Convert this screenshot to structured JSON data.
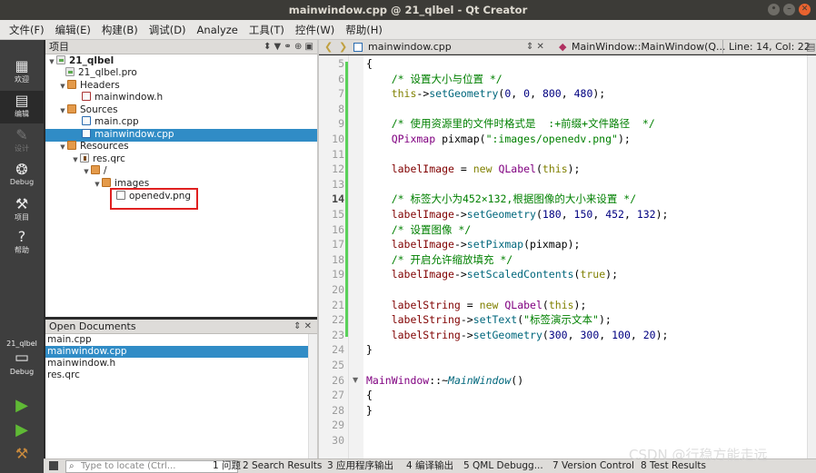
{
  "window": {
    "title": "mainwindow.cpp @ 21_qlbel - Qt Creator",
    "buttons": [
      "•",
      "–",
      "✕"
    ]
  },
  "menubar": [
    "文件(F)",
    "编辑(E)",
    "构建(B)",
    "调试(D)",
    "Analyze",
    "工具(T)",
    "控件(W)",
    "帮助(H)"
  ],
  "modes": [
    {
      "label": "欢迎",
      "icon": "grid-icon",
      "glyph": "▦"
    },
    {
      "label": "编辑",
      "icon": "edit-icon",
      "glyph": "▤"
    },
    {
      "label": "设计",
      "icon": "design-icon",
      "glyph": "✎"
    },
    {
      "label": "Debug",
      "icon": "bug-icon",
      "glyph": "❂"
    },
    {
      "label": "项目",
      "icon": "wrench-icon",
      "glyph": "⚒"
    },
    {
      "label": "帮助",
      "icon": "help-icon",
      "glyph": "?"
    }
  ],
  "kit": {
    "name": "21_qlbel",
    "mode": "Debug"
  },
  "project_pane": {
    "title": "项目",
    "controls": "⬍  ▼ ⚭ ⊕ ▣"
  },
  "tree": [
    {
      "label": "21_qlbel",
      "bold": true,
      "depth": 0,
      "icon": "pro",
      "expanded": true
    },
    {
      "label": "21_qlbel.pro",
      "depth": 1,
      "icon": "pro"
    },
    {
      "label": "Headers",
      "depth": 1,
      "icon": "folder",
      "expanded": true
    },
    {
      "label": "mainwindow.h",
      "depth": 2,
      "icon": "h"
    },
    {
      "label": "Sources",
      "depth": 1,
      "icon": "folder",
      "expanded": true
    },
    {
      "label": "main.cpp",
      "depth": 2,
      "icon": "cpp"
    },
    {
      "label": "mainwindow.cpp",
      "depth": 2,
      "icon": "cpp",
      "selected": true
    },
    {
      "label": "Resources",
      "depth": 1,
      "icon": "folder",
      "expanded": true
    },
    {
      "label": "res.qrc",
      "depth": 2,
      "icon": "qrc",
      "expanded": true
    },
    {
      "label": "/",
      "depth": 3,
      "icon": "folder",
      "expanded": true
    },
    {
      "label": "images",
      "depth": 4,
      "icon": "folder",
      "expanded": true
    },
    {
      "label": "openedv.png",
      "depth": 5,
      "icon": "png"
    }
  ],
  "open_docs": {
    "title": "Open Documents",
    "controls": "⇕ ✕",
    "items": [
      {
        "label": "main.cpp"
      },
      {
        "label": "mainwindow.cpp",
        "selected": true
      },
      {
        "label": "mainwindow.h"
      },
      {
        "label": "res.qrc"
      }
    ]
  },
  "editor_toolbar": {
    "back": "❮",
    "forward": "❯",
    "file": "mainwindow.cpp",
    "file_controls": "⇕ ✕",
    "symbol": "MainWindow::MainWindow(Q...",
    "position": "Line: 14, Col: 22"
  },
  "code_lines": [
    {
      "n": 5,
      "t": [
        [
          "{",
          "pl"
        ]
      ]
    },
    {
      "n": 6,
      "t": [
        [
          "    /* 设置大小与位置 */",
          "cm"
        ]
      ]
    },
    {
      "n": 7,
      "t": [
        [
          "    this",
          "kw"
        ],
        [
          "->",
          "pl"
        ],
        [
          "setGeometry",
          "fn"
        ],
        [
          "(",
          "pl"
        ],
        [
          "0",
          "nm"
        ],
        [
          ", ",
          "pl"
        ],
        [
          "0",
          "nm"
        ],
        [
          ", ",
          "pl"
        ],
        [
          "800",
          "nm"
        ],
        [
          ", ",
          "pl"
        ],
        [
          "480",
          "nm"
        ],
        [
          ");",
          "pl"
        ]
      ]
    },
    {
      "n": 8,
      "t": []
    },
    {
      "n": 9,
      "t": [
        [
          "    /* 使用资源里的文件时格式是  :+前缀+文件路径  */",
          "cm"
        ]
      ]
    },
    {
      "n": 10,
      "t": [
        [
          "    QPixmap",
          "ty"
        ],
        [
          " pixmap(",
          "pl"
        ],
        [
          "\":images/openedv.png\"",
          "st"
        ],
        [
          ");",
          "pl"
        ]
      ]
    },
    {
      "n": 11,
      "t": []
    },
    {
      "n": 12,
      "t": [
        [
          "    labelImage",
          "mb"
        ],
        [
          " = ",
          "pl"
        ],
        [
          "new",
          "kw"
        ],
        [
          " ",
          "pl"
        ],
        [
          "QLabel",
          "ty"
        ],
        [
          "(",
          "pl"
        ],
        [
          "this",
          "kw"
        ],
        [
          ");",
          "pl"
        ]
      ]
    },
    {
      "n": 13,
      "t": []
    },
    {
      "n": 14,
      "t": [
        [
          "    /* 标签大小为452×132,根据图像的大小来设置 */",
          "cm"
        ]
      ],
      "cur": true
    },
    {
      "n": 15,
      "t": [
        [
          "    labelImage",
          "mb"
        ],
        [
          "->",
          "pl"
        ],
        [
          "setGeometry",
          "fn"
        ],
        [
          "(",
          "pl"
        ],
        [
          "180",
          "nm"
        ],
        [
          ", ",
          "pl"
        ],
        [
          "150",
          "nm"
        ],
        [
          ", ",
          "pl"
        ],
        [
          "452",
          "nm"
        ],
        [
          ", ",
          "pl"
        ],
        [
          "132",
          "nm"
        ],
        [
          ");",
          "pl"
        ]
      ]
    },
    {
      "n": 16,
      "t": [
        [
          "    /* 设置图像 */",
          "cm"
        ]
      ]
    },
    {
      "n": 17,
      "t": [
        [
          "    labelImage",
          "mb"
        ],
        [
          "->",
          "pl"
        ],
        [
          "setPixmap",
          "fn"
        ],
        [
          "(pixmap);",
          "pl"
        ]
      ]
    },
    {
      "n": 18,
      "t": [
        [
          "    /* 开启允许缩放填充 */",
          "cm"
        ]
      ]
    },
    {
      "n": 19,
      "t": [
        [
          "    labelImage",
          "mb"
        ],
        [
          "->",
          "pl"
        ],
        [
          "setScaledContents",
          "fn"
        ],
        [
          "(",
          "pl"
        ],
        [
          "true",
          "kw"
        ],
        [
          ");",
          "pl"
        ]
      ]
    },
    {
      "n": 20,
      "t": []
    },
    {
      "n": 21,
      "t": [
        [
          "    labelString",
          "mb"
        ],
        [
          " = ",
          "pl"
        ],
        [
          "new",
          "kw"
        ],
        [
          " ",
          "pl"
        ],
        [
          "QLabel",
          "ty"
        ],
        [
          "(",
          "pl"
        ],
        [
          "this",
          "kw"
        ],
        [
          ");",
          "pl"
        ]
      ]
    },
    {
      "n": 22,
      "t": [
        [
          "    labelString",
          "mb"
        ],
        [
          "->",
          "pl"
        ],
        [
          "setText",
          "fn"
        ],
        [
          "(",
          "pl"
        ],
        [
          "\"标签演示文本\"",
          "st"
        ],
        [
          ");",
          "pl"
        ]
      ]
    },
    {
      "n": 23,
      "t": [
        [
          "    labelString",
          "mb"
        ],
        [
          "->",
          "pl"
        ],
        [
          "setGeometry",
          "fn"
        ],
        [
          "(",
          "pl"
        ],
        [
          "300",
          "nm"
        ],
        [
          ", ",
          "pl"
        ],
        [
          "300",
          "nm"
        ],
        [
          ", ",
          "pl"
        ],
        [
          "100",
          "nm"
        ],
        [
          ", ",
          "pl"
        ],
        [
          "20",
          "nm"
        ],
        [
          ");",
          "pl"
        ]
      ]
    },
    {
      "n": 24,
      "t": [
        [
          "}",
          "pl"
        ]
      ]
    },
    {
      "n": 25,
      "t": []
    },
    {
      "n": 26,
      "t": [
        [
          "MainWindow",
          "ty"
        ],
        [
          "::~",
          "pl"
        ],
        [
          "MainWindow",
          "it"
        ],
        [
          "()",
          "pl"
        ]
      ],
      "fold": true
    },
    {
      "n": 27,
      "t": [
        [
          "{",
          "pl"
        ]
      ]
    },
    {
      "n": 28,
      "t": [
        [
          "}",
          "pl"
        ]
      ]
    },
    {
      "n": 29,
      "t": []
    },
    {
      "n": 30,
      "t": []
    }
  ],
  "statusbar": {
    "locate_placeholder": "Type to locate (Ctrl...",
    "panes": [
      "1 问题",
      "2 Search Results",
      "3 应用程序输出",
      "4 编译输出",
      "5 QML Debugg...",
      "7 Version Control",
      "8 Test Results"
    ]
  },
  "watermark": "CSDN @行稳方能走远",
  "colors": {
    "selection": "#308cc6",
    "changed_lines": "#5ad15a",
    "highlight_box": "#e02020"
  }
}
